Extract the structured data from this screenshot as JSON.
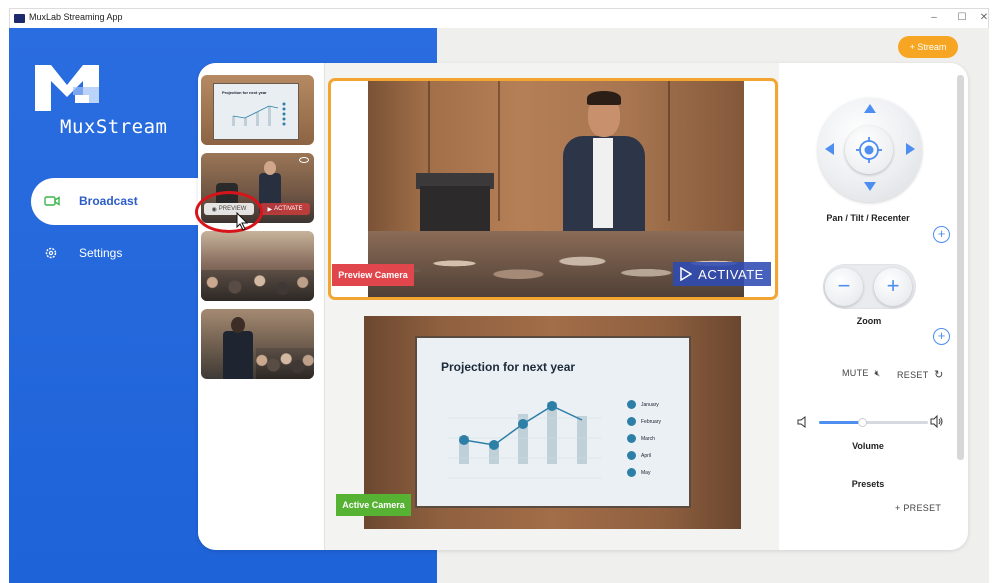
{
  "window": {
    "title": "MuxLab Streaming App",
    "minimize": "–",
    "maximize": "☐",
    "close": "✕"
  },
  "brand": {
    "logo_text": "MuxStream"
  },
  "nav": {
    "items": [
      {
        "label": "Broadcast",
        "icon": "camera-icon",
        "active": true
      },
      {
        "label": "Settings",
        "icon": "gear-icon",
        "active": false
      }
    ]
  },
  "header": {
    "stream_button": "+ Stream"
  },
  "thumbnails": {
    "thumb1_title": "Projection for next year",
    "preview_label": "PREVIEW",
    "activate_label": "ACTIVATE"
  },
  "preview": {
    "label": "Preview Camera",
    "activate_button": "ACTIVATE"
  },
  "active": {
    "label": "Active Camera",
    "slide_title": "Projection for next year",
    "legend": [
      "January",
      "February",
      "March",
      "April",
      "May"
    ]
  },
  "controls": {
    "ptz_label": "Pan / Tilt / Recenter",
    "zoom_label": "Zoom",
    "zoom_minus": "−",
    "zoom_plus": "+",
    "add_symbol": "+",
    "mute_label": "MUTE",
    "reset_label": "RESET",
    "volume_label": "Volume",
    "volume_level": 0.4,
    "presets_label": "Presets",
    "preset_button": "+ PRESET"
  },
  "colors": {
    "brand_blue": "#1e63d8",
    "accent_orange": "#f6a623",
    "preview_red": "#e0464b",
    "active_green": "#55b232",
    "control_blue": "#4d8ef0"
  }
}
